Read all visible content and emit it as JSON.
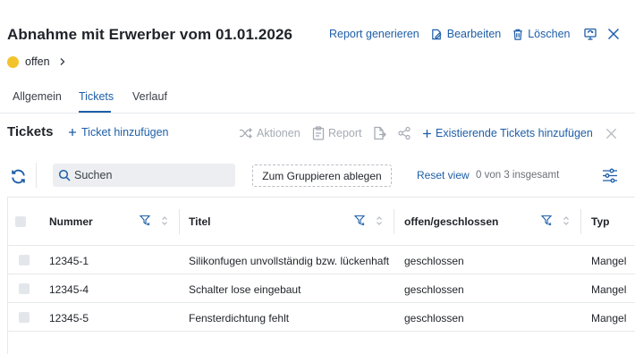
{
  "header": {
    "title": "Abnahme mit Erwerber vom 01.01.2026",
    "actions": {
      "report": "Report generieren",
      "edit": "Bearbeiten",
      "delete": "Löschen"
    },
    "status": "offen"
  },
  "tabs": [
    {
      "label": "Allgemein"
    },
    {
      "label": "Tickets"
    },
    {
      "label": "Verlauf"
    }
  ],
  "active_tab": "Tickets",
  "tickets_section": {
    "title": "Tickets",
    "add_ticket": "Ticket hinzufügen",
    "actions_label": "Aktionen",
    "report_label": "Report",
    "add_existing": "Existierende Tickets hinzufügen"
  },
  "toolbar": {
    "search_placeholder": "Suchen",
    "group_drop": "Zum Gruppieren ablegen",
    "reset_view": "Reset view",
    "count": "0 von 3 insgesamt"
  },
  "table": {
    "columns": [
      "Nummer",
      "Titel",
      "offen/geschlossen",
      "Typ"
    ],
    "rows": [
      {
        "nummer": "12345-1",
        "titel": "Silikonfugen unvollständig bzw. lückenhaft",
        "status": "geschlossen",
        "typ": "Mangel"
      },
      {
        "nummer": "12345-4",
        "titel": "Schalter lose eingebaut",
        "status": "geschlossen",
        "typ": "Mangel"
      },
      {
        "nummer": "12345-5",
        "titel": "Fensterdichtung fehlt",
        "status": "geschlossen",
        "typ": "Mangel"
      }
    ]
  },
  "colors": {
    "accent": "#1d5ea8",
    "status_dot": "#f2c32c",
    "disabled": "#a5abb3"
  },
  "icons": [
    "file-edit-icon",
    "trash-icon",
    "monitor-sync-icon",
    "close-icon",
    "chevron-right-icon",
    "plus-icon",
    "shuffle-icon",
    "clipboard-icon",
    "export-icon",
    "share-icon",
    "refresh-icon",
    "search-icon",
    "settings-sliders-icon",
    "filter-icon",
    "sort-icon"
  ]
}
